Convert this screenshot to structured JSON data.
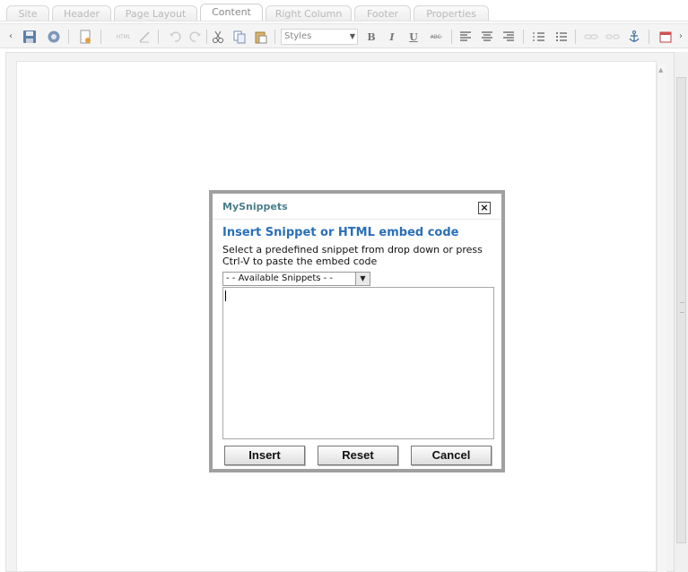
{
  "tabs": [
    "Site",
    "Header",
    "Page Layout",
    "Content",
    "Right Column",
    "Footer",
    "Properties"
  ],
  "active_tab": "Content",
  "toolbar": {
    "styles_value": "Styles",
    "icons": [
      "chevron-left-icon",
      "save-icon",
      "preview-icon",
      "new-page-icon",
      "source-icon",
      "spellcheck-icon",
      "undo-icon",
      "redo-icon",
      "cut-icon",
      "copy-icon",
      "paste-icon",
      "bold-icon",
      "italic-icon",
      "underline-icon",
      "strikethrough-icon",
      "align-left-icon",
      "align-center-icon",
      "align-right-icon",
      "ordered-list-icon",
      "unordered-list-icon",
      "link-icon",
      "unlink-icon",
      "anchor-icon",
      "calendar-icon",
      "chevron-right-icon"
    ]
  },
  "dialog": {
    "title": "MySnippets",
    "close_label": "×",
    "heading": "Insert Snippet or HTML embed code",
    "description": "Select a predefined snippet from drop down or press Ctrl-V to paste the embed code",
    "select_value": "- - Available Snippets - -",
    "textarea_value": "",
    "buttons": {
      "insert": "Insert",
      "reset": "Reset",
      "cancel": "Cancel"
    }
  }
}
